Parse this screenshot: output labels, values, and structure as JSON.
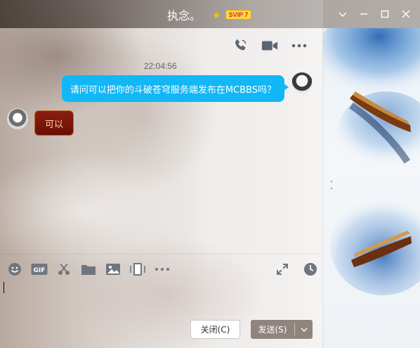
{
  "window": {
    "title": "执念。",
    "vip_badge": "SVIP 7",
    "star_icon": "star-icon",
    "controls": [
      "chevron-down-icon",
      "minimize-icon",
      "maximize-icon",
      "close-icon"
    ]
  },
  "chat_toolbar": [
    "voice-call-icon",
    "video-call-icon",
    "more-icon"
  ],
  "conversation": {
    "timestamp": "22:04:56",
    "messages": [
      {
        "from": "self",
        "text": "请问可以把你的斗破苍穹服务端发布在MCBBS吗？"
      },
      {
        "from": "other",
        "text": "可以"
      }
    ]
  },
  "input_toolbar": {
    "left_icons": [
      "emoji-icon",
      "gif-icon",
      "scissors-icon",
      "folder-icon",
      "image-icon",
      "screen-share-icon",
      "more-icon"
    ],
    "gif_label": "GIF",
    "right_icons": [
      "expand-icon",
      "history-icon"
    ]
  },
  "input": {
    "value": ""
  },
  "actions": {
    "close_label": "关闭(C)",
    "send_label": "发送(S)"
  },
  "colors": {
    "accent": "#12b7f5",
    "send_button": "#8f857e",
    "incoming_bubble": "#7a1709"
  }
}
